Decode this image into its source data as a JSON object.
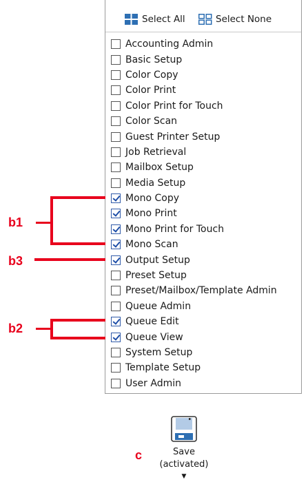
{
  "header": {
    "select_all_label": "Select All",
    "select_none_label": "Select None"
  },
  "roles": [
    {
      "label": "Accounting Admin",
      "checked": false
    },
    {
      "label": "Basic Setup",
      "checked": false
    },
    {
      "label": "Color Copy",
      "checked": false
    },
    {
      "label": "Color Print",
      "checked": false
    },
    {
      "label": "Color Print for Touch",
      "checked": false
    },
    {
      "label": "Color Scan",
      "checked": false
    },
    {
      "label": "Guest Printer Setup",
      "checked": false
    },
    {
      "label": "Job Retrieval",
      "checked": false
    },
    {
      "label": "Mailbox Setup",
      "checked": false
    },
    {
      "label": "Media Setup",
      "checked": false
    },
    {
      "label": "Mono Copy",
      "checked": true
    },
    {
      "label": "Mono Print",
      "checked": true
    },
    {
      "label": "Mono Print for Touch",
      "checked": true
    },
    {
      "label": "Mono Scan",
      "checked": true
    },
    {
      "label": "Output Setup",
      "checked": true
    },
    {
      "label": "Preset Setup",
      "checked": false
    },
    {
      "label": "Preset/Mailbox/Template Admin",
      "checked": false
    },
    {
      "label": "Queue Admin",
      "checked": false
    },
    {
      "label": "Queue Edit",
      "checked": true
    },
    {
      "label": "Queue View",
      "checked": true
    },
    {
      "label": "System Setup",
      "checked": false
    },
    {
      "label": "Template Setup",
      "checked": false
    },
    {
      "label": "User Admin",
      "checked": false
    }
  ],
  "annotations": {
    "b1": "b1",
    "b2": "b2",
    "b3": "b3",
    "c": "c"
  },
  "save": {
    "label": "Save",
    "state": "(activated)",
    "icon": "floppy-disk-icon"
  },
  "colors": {
    "annotation": "#e8001c",
    "checkmark": "#1f4fa8",
    "icon_blue": "#2e6fb3"
  }
}
